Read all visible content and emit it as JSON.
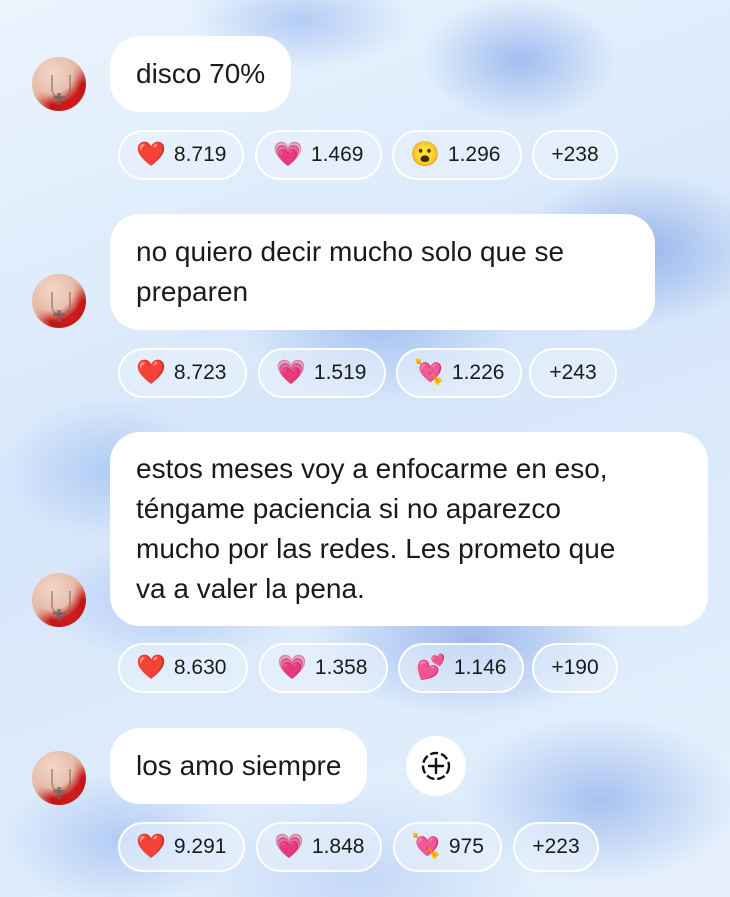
{
  "messages": [
    {
      "text": "disco 70%",
      "reactions": [
        {
          "emoji": "❤️",
          "icon": "red-heart-icon",
          "count": "8.719"
        },
        {
          "emoji": "💗",
          "icon": "growing-heart-icon",
          "count": "1.469"
        },
        {
          "emoji": "😮",
          "icon": "surprised-face-icon",
          "count": "1.296"
        }
      ],
      "more": "+238"
    },
    {
      "text_lines": [
        "no quiero decir mucho solo que se",
        "preparen"
      ],
      "reactions": [
        {
          "emoji": "❤️",
          "icon": "red-heart-icon",
          "count": "8.723"
        },
        {
          "emoji": "💗",
          "icon": "growing-heart-icon",
          "count": "1.519"
        },
        {
          "emoji": "💘",
          "icon": "heart-arrow-icon",
          "count": "1.226"
        }
      ],
      "more": "+243"
    },
    {
      "text_lines": [
        "estos meses voy a enfocarme en eso,",
        "téngame paciencia si no aparezco",
        "mucho por las redes. Les prometo que",
        "va a valer la pena."
      ],
      "reactions": [
        {
          "emoji": "❤️",
          "icon": "red-heart-icon",
          "count": "8.630"
        },
        {
          "emoji": "💗",
          "icon": "growing-heart-icon",
          "count": "1.358"
        },
        {
          "emoji": "💕",
          "icon": "two-hearts-icon",
          "count": "1.146"
        }
      ],
      "more": "+190"
    },
    {
      "text": "los amo siempre",
      "reactions": [
        {
          "emoji": "❤️",
          "icon": "red-heart-icon",
          "count": "9.291"
        },
        {
          "emoji": "💗",
          "icon": "growing-heart-icon",
          "count": "1.848"
        },
        {
          "emoji": "💘",
          "icon": "heart-arrow-icon",
          "count": "975"
        }
      ],
      "more": "+223",
      "add_reaction_icon": "add-reaction-icon"
    }
  ],
  "colors": {
    "bubble": "#ffffff",
    "text": "#1a1a1a",
    "background": "#dfeefb"
  }
}
